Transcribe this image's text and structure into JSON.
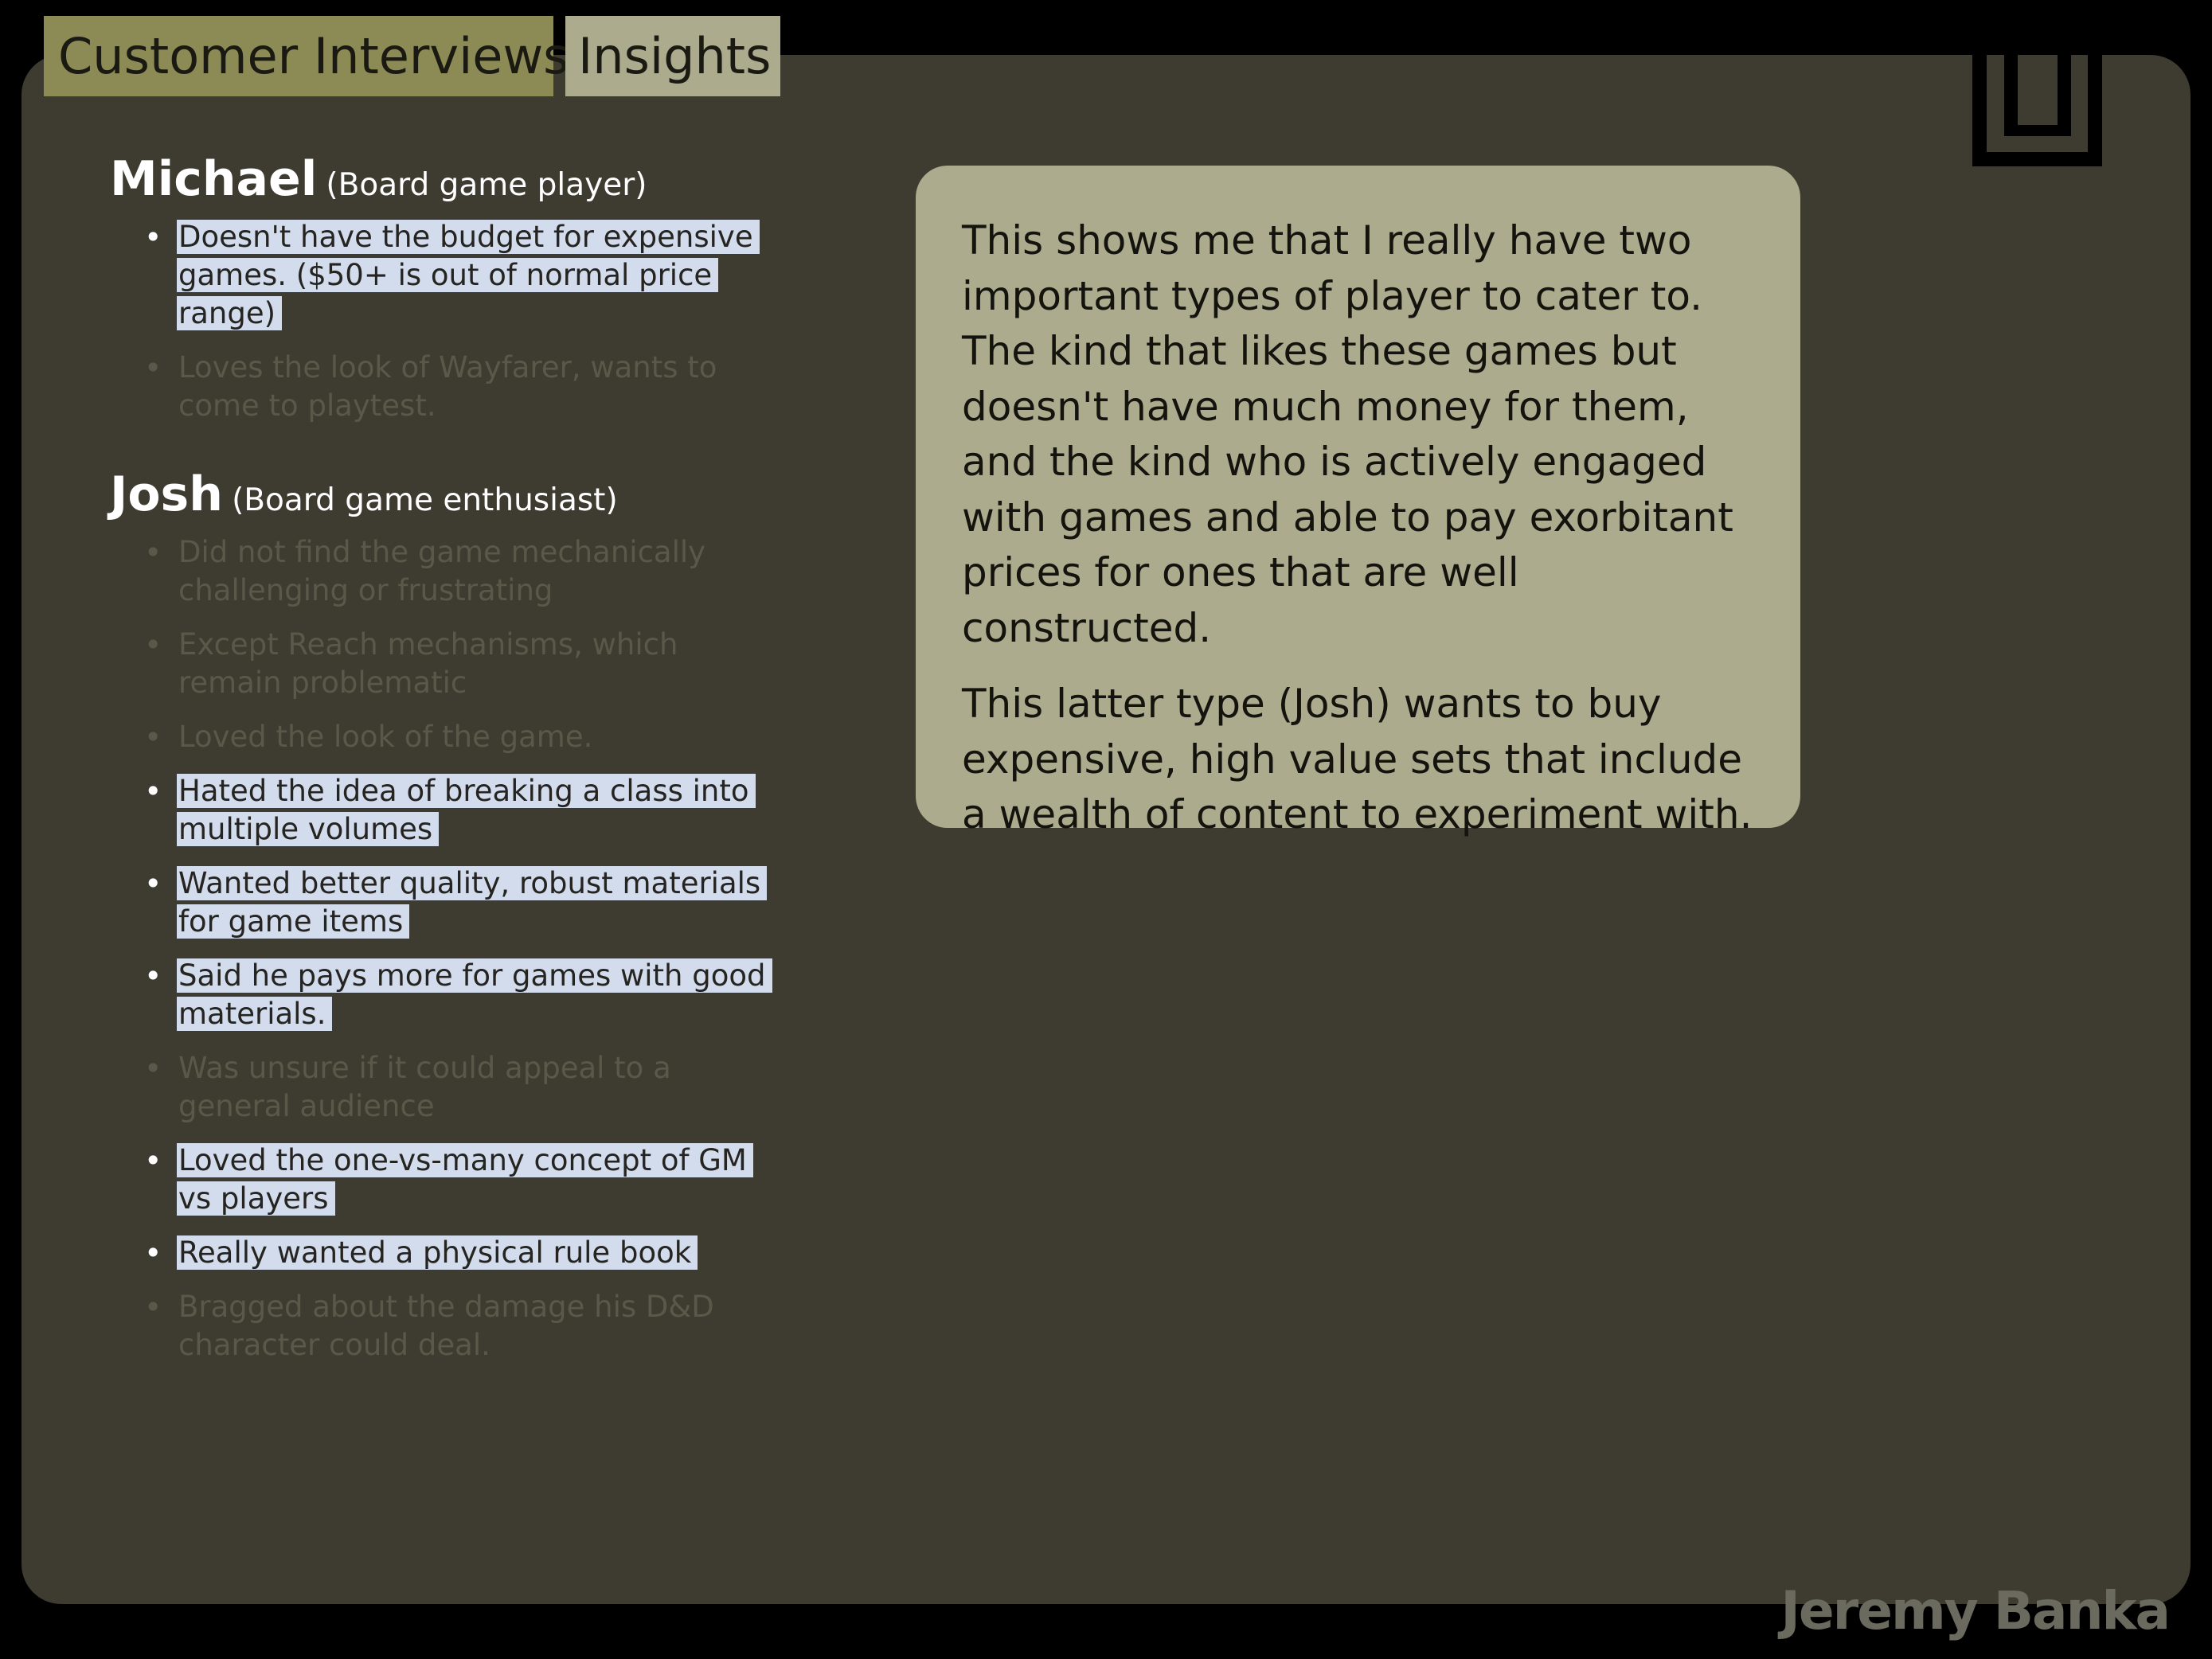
{
  "tabs": {
    "customer_interviews": "Customer Interviews",
    "insights": "Insights"
  },
  "logo": {
    "icon": "bracket-logo-icon"
  },
  "interviews": {
    "michael": {
      "name": "Michael",
      "role": "(Board game player)",
      "notes": [
        {
          "text": "Doesn't have the budget for expensive games. ($50+ is out of normal price range)",
          "highlighted": true
        },
        {
          "text": "Loves the look of Wayfarer, wants to come to playtest.",
          "highlighted": false
        }
      ]
    },
    "josh": {
      "name": "Josh",
      "role": "(Board game enthusiast)",
      "notes": [
        {
          "text": "Did not find the game mechanically challenging or frustrating",
          "highlighted": false
        },
        {
          "text": "Except Reach mechanisms, which remain problematic",
          "highlighted": false
        },
        {
          "text": "Loved the look of the game.",
          "highlighted": false
        },
        {
          "text": "Hated the idea of breaking a class into multiple volumes",
          "highlighted": true
        },
        {
          "text": "Wanted better quality, robust materials for game items",
          "highlighted": true
        },
        {
          "text": "Said he pays more for games with good materials.",
          "highlighted": true
        },
        {
          "text": "Was unsure if it could appeal to a general audience",
          "highlighted": false
        },
        {
          "text": "Loved the one-vs-many concept of GM vs players",
          "highlighted": true
        },
        {
          "text": "Really wanted a physical rule book",
          "highlighted": true
        },
        {
          "text": "Bragged about the damage his D&D character could deal.",
          "highlighted": false
        }
      ]
    }
  },
  "insight": {
    "paragraph_1": "This shows me that I really have two important types of player to cater to. The kind that likes these games but doesn't have much money for them, and the kind who is actively engaged with games and able to pay exorbitant prices for ones that are well constructed.",
    "paragraph_2": "This latter type (Josh) wants to buy expensive, high value sets that include a wealth of content to experiment with."
  },
  "author": "Jeremy Banka",
  "colors": {
    "panel": "#3e3c31",
    "tab_active": "#8c8a55",
    "tab_inactive": "#adab8d",
    "highlight": "#d2dcec",
    "insight_box": "#adab8d"
  }
}
